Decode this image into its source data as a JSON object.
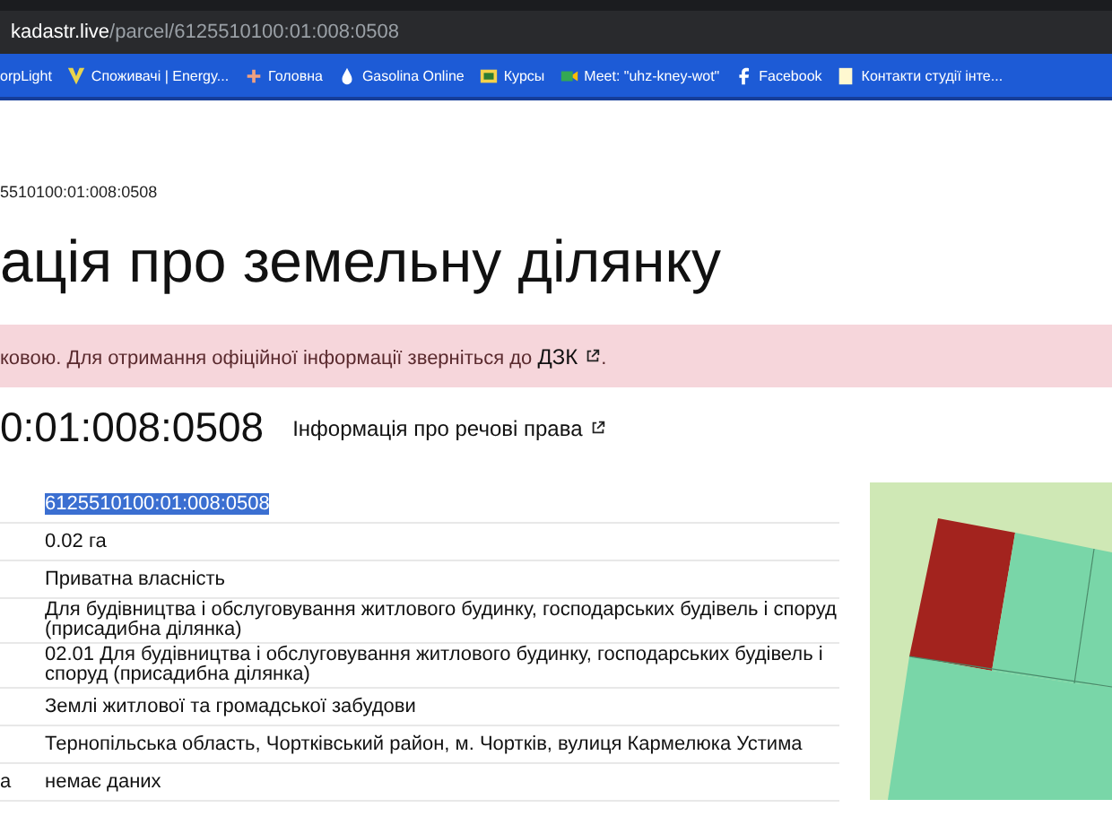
{
  "address_bar": {
    "domain": "kadastr.live",
    "path": "/parcel/6125510100:01:008:0508"
  },
  "bookmarks": [
    {
      "label": "orpLight"
    },
    {
      "label": "Споживачі | Energy..."
    },
    {
      "label": "Головна"
    },
    {
      "label": "Gasolina Online"
    },
    {
      "label": "Курсы"
    },
    {
      "label": "Meet: \"uhz-kney-wot\""
    },
    {
      "label": "Facebook"
    },
    {
      "label": "Контакти студії інте..."
    }
  ],
  "breadcrumb": "5510100:01:008:0508",
  "heading": "ація про земельну ділянку",
  "notice": {
    "text": "ковою. Для отримання офіційної інформації зверніться до ",
    "link": "ДЗК",
    "tail": "."
  },
  "parcel_number": "0:01:008:0508",
  "rights_link": "Інформація про речові права",
  "table": {
    "rows": [
      {
        "value": "6125510100:01:008:0508",
        "highlighted": true
      },
      {
        "value": "0.02 га",
        "highlighted": false
      },
      {
        "value": "Приватна власність",
        "highlighted": false
      },
      {
        "value": "Для будівництва і обслуговування житлового будинку, господарських будівель і споруд (присадибна ділянка)",
        "highlighted": false
      },
      {
        "value": "02.01 Для будівництва і обслуговування житлового будинку, господарських будівель і споруд (присадибна ділянка)",
        "highlighted": false
      },
      {
        "value": "Землі житлової та громадської забудови",
        "highlighted": false
      },
      {
        "value": "Тернопільська область, Чортківський район, м. Чортків, вулиця Кармелюка Устима",
        "highlighted": false
      },
      {
        "label": "а",
        "value": "немає даних",
        "highlighted": false
      }
    ]
  }
}
